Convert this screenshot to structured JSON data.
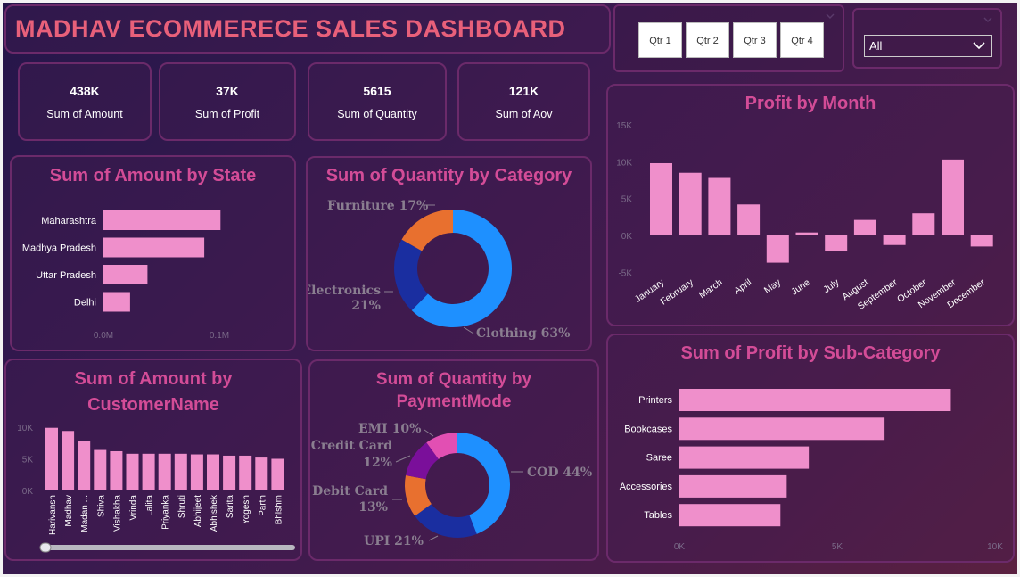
{
  "dashboard": {
    "title": "MADHAV ECOMMERECE  SALES DASHBOARD"
  },
  "colors": {
    "accent": "#d34c97",
    "title": "#e8607a",
    "bar": "#ef8fcb",
    "donut_blue": "#1e90ff",
    "donut_navy": "#1a2ea0",
    "donut_orange": "#e8702f",
    "donut_purple": "#7a0f9a",
    "donut_pink": "#e24fb3"
  },
  "kpis": [
    {
      "value": "438K",
      "label": "Sum of Amount"
    },
    {
      "value": "37K",
      "label": "Sum of Profit"
    },
    {
      "value": "5615",
      "label": "Sum of Quantity"
    },
    {
      "value": "121K",
      "label": "Sum of Aov"
    }
  ],
  "slicers": {
    "quarter": {
      "options": [
        "Qtr 1",
        "Qtr 2",
        "Qtr 3",
        "Qtr 4"
      ]
    },
    "state": {
      "selected": "All"
    }
  },
  "charts": {
    "amount_by_state": {
      "title": "Sum of Amount by State",
      "chart_data": {
        "type": "bar",
        "orientation": "horizontal",
        "categories": [
          "Maharashtra",
          "Madhya Pradesh",
          "Uttar Pradesh",
          "Delhi"
        ],
        "values": [
          0.101,
          0.087,
          0.038,
          0.023
        ],
        "xticks": [
          "0.0M",
          "0.1M"
        ],
        "xlim": [
          0,
          0.1
        ],
        "grid": false
      }
    },
    "quantity_by_category": {
      "title": "Sum of Quantity by Category",
      "chart_data": {
        "type": "pie",
        "style": "donut",
        "labels": [
          "Clothing",
          "Electronics",
          "Furniture"
        ],
        "values": [
          63,
          21,
          17
        ],
        "data_labels": [
          "Clothing 63%",
          "Electronics 21%",
          "Furniture 17%"
        ]
      }
    },
    "profit_by_month": {
      "title": "Profit by Month",
      "chart_data": {
        "type": "bar",
        "categories": [
          "January",
          "February",
          "March",
          "April",
          "May",
          "June",
          "July",
          "August",
          "September",
          "October",
          "November",
          "December"
        ],
        "values": [
          9800,
          8500,
          7800,
          4200,
          -3700,
          400,
          -2100,
          2100,
          -1300,
          3000,
          10300,
          -1500
        ],
        "yticks": [
          "15K",
          "10K",
          "5K",
          "0K",
          "-5K"
        ],
        "ylim": [
          -5000,
          15000
        ],
        "grid": false
      }
    },
    "amount_by_customer": {
      "title": "Sum of Amount by CustomerName",
      "chart_data": {
        "type": "bar",
        "categories": [
          "Harivansh",
          "Madhav",
          "Madan ...",
          "Shiva",
          "Vishakha",
          "Vrinda",
          "Lalita",
          "Priyanka",
          "Shruti",
          "Abhijeet",
          "Abhishek",
          "Sarita",
          "Yogesh",
          "Parth",
          "Bhishm"
        ],
        "values": [
          9900,
          9400,
          7800,
          6400,
          6200,
          5800,
          5800,
          5800,
          5800,
          5700,
          5700,
          5500,
          5500,
          5200,
          5000
        ],
        "yticks": [
          "10K",
          "5K",
          "0K"
        ],
        "ylim": [
          0,
          10000
        ],
        "grid": false
      }
    },
    "quantity_by_paymentmode": {
      "title": "Sum of Quantity by PaymentMode",
      "chart_data": {
        "type": "pie",
        "style": "donut",
        "labels": [
          "COD",
          "UPI",
          "Debit Card",
          "Credit Card",
          "EMI"
        ],
        "values": [
          44,
          21,
          13,
          12,
          10
        ],
        "data_labels": [
          "COD 44%",
          "UPI 21%",
          "Debit Card 13%",
          "Credit Card 12%",
          "EMI 10%"
        ]
      }
    },
    "profit_by_subcategory": {
      "title": "Sum of Profit by Sub-Category",
      "chart_data": {
        "type": "bar",
        "orientation": "horizontal",
        "categories": [
          "Printers",
          "Bookcases",
          "Saree",
          "Accessories",
          "Tables"
        ],
        "values": [
          8600,
          6500,
          4100,
          3400,
          3200
        ],
        "xticks": [
          "0K",
          "5K",
          "10K"
        ],
        "xlim": [
          0,
          10000
        ],
        "grid": false
      }
    }
  }
}
